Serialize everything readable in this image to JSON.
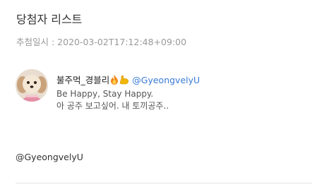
{
  "page": {
    "title": "당첨자 리스트",
    "draw_time": "추첨일시 : 2020-03-02T17:12:48+09:00"
  },
  "winner": {
    "name": "불주먹_경블리",
    "emoji_icons": [
      "fire-icon",
      "flexed-biceps-icon"
    ],
    "handle": "@GyeongvelyU",
    "avatar_icon": "puppy-avatar",
    "tweet_lines": [
      "Be Happy, Stay Happy.",
      "아 공주 보고싶어. 내 토끼공주.."
    ]
  },
  "footer": {
    "handle": "@GyeongvelyU"
  },
  "colors": {
    "handle_link": "#3a7bd5",
    "muted_text": "#999999",
    "divider": "#e6e6e6"
  }
}
